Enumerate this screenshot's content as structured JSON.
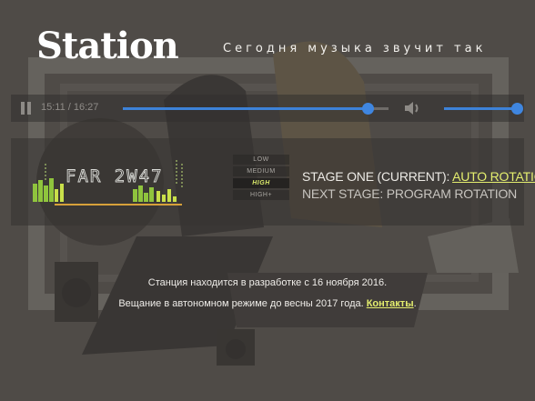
{
  "brand": {
    "logo_text": "Station",
    "tagline": "Сегодня музыка звучит так"
  },
  "player": {
    "time_display": "15:11 / 16:27",
    "progress_fraction": 0.92,
    "volume_fraction": 1.0,
    "icons": {
      "pause": "pause-icon",
      "volume": "speaker-icon"
    },
    "accent": "#3d82d8"
  },
  "visualizer": {
    "display_text": "FAR 2W47"
  },
  "quality": {
    "options": [
      "LOW",
      "MEDIUM",
      "HIGH",
      "HIGH+"
    ],
    "selected": "HIGH"
  },
  "stage": {
    "current_prefix": "STAGE ONE (CURRENT): ",
    "current_link": "AUTO ROTATION",
    "next": "NEXT STAGE: PROGRAM ROTATION"
  },
  "footer": {
    "dev_note": "Станция находится в разработке с 16 ноября 2016.",
    "broadcast_prefix": "Вещание в автономном режиме до весны 2017 года. ",
    "contacts_link": "Контакты",
    "broadcast_suffix": "."
  },
  "colors": {
    "link": "#e4ee6e",
    "background": "#5b5752"
  }
}
